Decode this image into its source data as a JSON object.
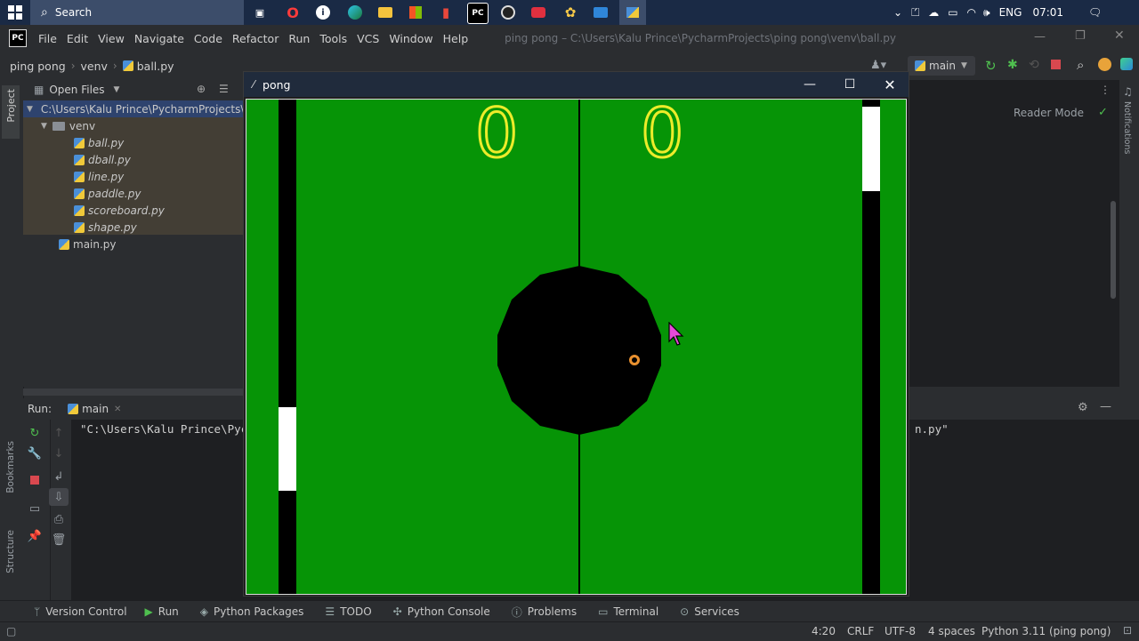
{
  "taskbar": {
    "search_placeholder": "Search",
    "language": "ENG",
    "clock": "07:01",
    "apps": [
      {
        "icon": "taskview-icon"
      },
      {
        "icon": "opera-icon"
      },
      {
        "icon": "app-i-icon"
      },
      {
        "icon": "edge-icon"
      },
      {
        "icon": "file-explorer-icon"
      },
      {
        "icon": "store-icon"
      },
      {
        "icon": "office-icon"
      },
      {
        "icon": "pycharm-icon"
      },
      {
        "icon": "obs-icon"
      },
      {
        "icon": "recorder-icon"
      },
      {
        "icon": "photos-icon"
      },
      {
        "icon": "mail-icon"
      },
      {
        "icon": "python-idle-icon"
      }
    ]
  },
  "menu": {
    "items": [
      "File",
      "Edit",
      "View",
      "Navigate",
      "Code",
      "Refactor",
      "Run",
      "Tools",
      "VCS",
      "Window",
      "Help"
    ],
    "title": "ping pong – C:\\Users\\Kalu Prince\\PycharmProjects\\ping pong\\venv\\ball.py"
  },
  "nav": {
    "crumbs": [
      "ping pong",
      "venv",
      "ball.py"
    ],
    "run_config": "main"
  },
  "project": {
    "view_label": "Open Files",
    "root": "C:\\Users\\Kalu Prince\\PycharmProjects\\ping pong",
    "folder": "venv",
    "files": [
      "ball.py",
      "dball.py",
      "line.py",
      "paddle.py",
      "scoreboard.py",
      "shape.py"
    ],
    "root_files": [
      "main.py"
    ]
  },
  "editor": {
    "reader_mode": "Reader Mode"
  },
  "side_labels": {
    "project": "Project",
    "bookmarks": "Bookmarks",
    "structure": "Structure",
    "notifications": "Notifications"
  },
  "run": {
    "label": "Run:",
    "tab": "main",
    "console_line_start": "\"C:\\Users\\Kalu Prince\\Pyc",
    "console_line_end": "n.py\""
  },
  "pong": {
    "title": "pong",
    "score_left": "0",
    "score_right": "0",
    "colors": {
      "field": "#069406",
      "score": "#ecec2a",
      "paddle": "#ffffff",
      "ball": "#000000"
    }
  },
  "toolwindows": [
    "Version Control",
    "Run",
    "Python Packages",
    "TODO",
    "Python Console",
    "Problems",
    "Terminal",
    "Services"
  ],
  "status": {
    "position": "4:20",
    "line_sep": "CRLF",
    "encoding": "UTF-8",
    "indent": "4 spaces",
    "interpreter": "Python 3.11 (ping pong)"
  }
}
